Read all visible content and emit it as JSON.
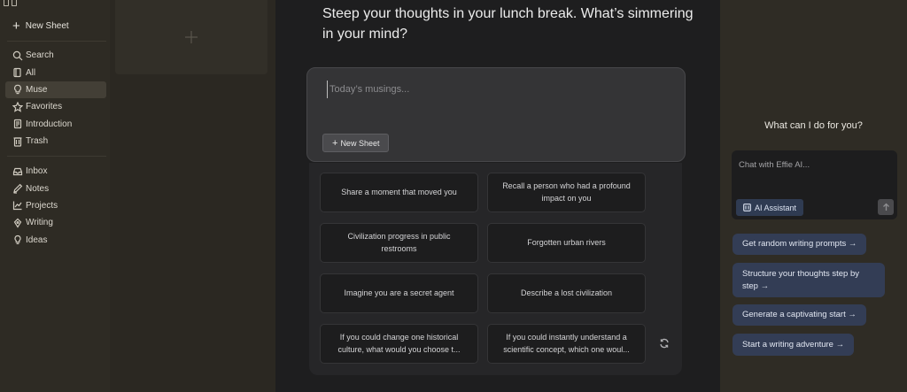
{
  "sidebar": {
    "new_sheet_label": "New Sheet",
    "group1": [
      {
        "label": "Search",
        "icon": "search-icon"
      },
      {
        "label": "All",
        "icon": "sheets-icon"
      },
      {
        "label": "Muse",
        "icon": "lightbulb-icon",
        "active": true
      },
      {
        "label": "Favorites",
        "icon": "star-icon"
      },
      {
        "label": "Introduction",
        "icon": "document-icon"
      },
      {
        "label": "Trash",
        "icon": "trash-icon"
      }
    ],
    "group2": [
      {
        "label": "Inbox",
        "icon": "inbox-icon"
      },
      {
        "label": "Notes",
        "icon": "pencil-icon"
      },
      {
        "label": "Projects",
        "icon": "chart-icon"
      },
      {
        "label": "Writing",
        "icon": "pen-nib-icon"
      },
      {
        "label": "Ideas",
        "icon": "idea-icon"
      }
    ]
  },
  "main": {
    "title": "Steep your thoughts in your lunch break. What’s simmering in your mind?",
    "editor": {
      "placeholder": "Today’s musings...",
      "button_label": "New Sheet"
    },
    "suggestions": [
      "Share a moment that moved you",
      "Recall a person who had a profound impact on you",
      "Civilization progress in public restrooms",
      "Forgotten urban rivers",
      "Imagine you are a secret agent",
      "Describe a lost civilization",
      "If you could change one historical culture, what would you choose t...",
      "If you could instantly understand a scientific concept, which one woul..."
    ]
  },
  "assistant": {
    "title": "What can I do for you?",
    "chat_placeholder": "Chat with Effie AI...",
    "ai_button_label": "AI Assistant",
    "quick_actions": [
      "Get random writing prompts →",
      "Structure your thoughts step by step →",
      "Generate a captivating start →",
      "Start a writing adventure →"
    ]
  },
  "colors": {
    "sidebar_bg": "#2e2b24",
    "main_bg": "#1e1e1f",
    "accent_blue": "#333d55",
    "active_item": "#433f36"
  }
}
